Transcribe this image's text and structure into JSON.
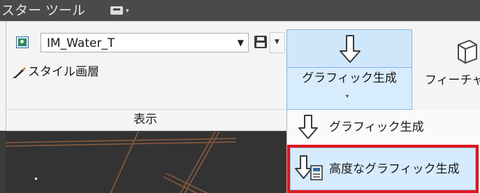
{
  "titlebar": {
    "title": "スター ツール",
    "quick_access_icon": "toolbar-box-icon",
    "quick_access_caret": "▾"
  },
  "ribbon": {
    "style_combo": {
      "value": "IM_Water_T",
      "icon": "layer-style-icon"
    },
    "save_icon": "floppy-disk-icon",
    "gallery_label": "スタイル画層",
    "group_label": "表示",
    "generate_button": {
      "label": "グラフィック生成",
      "icon": "down-arrow-icon",
      "caret": "▾"
    },
    "feature_button": {
      "label": "フィーチャ",
      "icon": "cube-icon"
    }
  },
  "menu": {
    "items": [
      {
        "label": "グラフィック生成",
        "icon": "down-arrow-icon"
      },
      {
        "label": "高度なグラフィック生成",
        "icon": "advanced-generate-icon",
        "highlighted": true
      }
    ]
  },
  "colors": {
    "highlight_border": "#e3141b",
    "button_hover": "#cfe7fb",
    "map_background": "#333333",
    "road_lines": "#8b5a3c"
  }
}
